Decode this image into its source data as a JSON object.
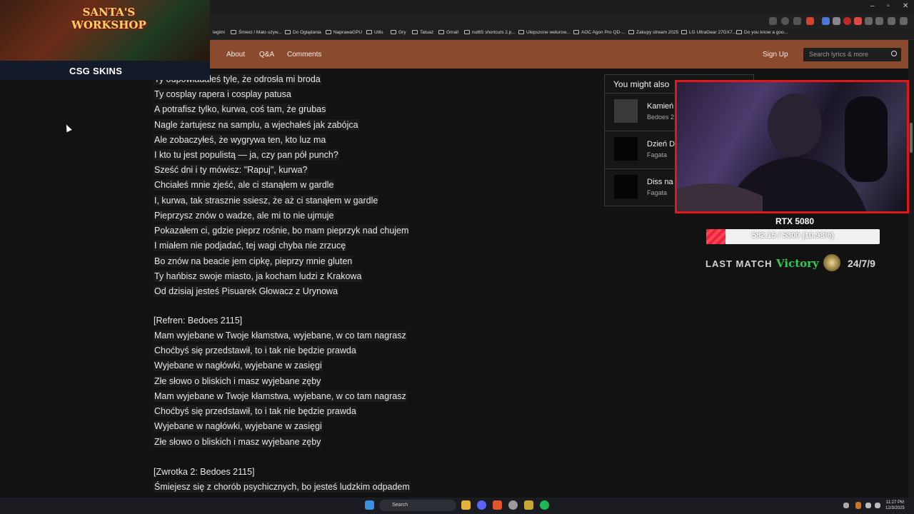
{
  "browser": {
    "bookmarks": [
      "legimi",
      "Śmieci / Mało używ...",
      "Do Oglądania",
      "NaprawaGPU",
      "Utils",
      "Gry",
      "Tatuaż",
      "Gmail",
      "nut65 shortcuts 2.p...",
      "Ulepszone welurow...",
      "AOC Agon Pro QD-...",
      "Zakupy stream 2025",
      "LG UltraGear 27GX7...",
      "Do you know a goo..."
    ]
  },
  "site": {
    "nav": [
      "About",
      "Q&A",
      "Comments"
    ],
    "sign_up": "Sign Up",
    "search_placeholder": "Search lyrics & more"
  },
  "lyrics": [
    "Ty odpowiadałeś tyle, że odrosła mi broda",
    "Ty cosplay rapera i cosplay patusa",
    "A potrafisz tylko, kurwa, coś tam, że grubas",
    "Nagle żartujesz na samplu, a wjechałeś jak zabójca",
    "Ale zobaczyłeś, że wygrywa ten, kto luz ma",
    "I kto tu jest populistą — ja, czy pan pół punch?",
    "Sześć dni i ty mówisz: \"Rapuj\", kurwa?",
    "Chciałeś mnie zjeść, ale ci stanąłem w gardle",
    "I, kurwa, tak strasznie ssiesz, że aż ci stanąłem w gardle",
    "Pieprzysz znów o wadze, ale mi to nie ujmuje",
    "Pokazałem ci, gdzie pieprz rośnie, bo mam pieprzyk nad chujem",
    "I miałem nie podjadać, tej wagi chyba nie zrzucę",
    "Bo znów na beacie jem cipkę, pieprzy mnie gluten",
    "Ty hańbisz swoje miasto, ja kocham ludzi z Krakowa",
    "Od dzisiaj jesteś Pisuarek Głowacz z Urynowa"
  ],
  "refrain_header": "[Refren: Bedoes 2115]",
  "refrain": [
    "Mam wyjebane w Twoje kłamstwa, wyjebane, w co tam nagrasz",
    "Choćbyś się przedstawił, to i tak nie będzie prawda",
    "Wyjebane w nagłówki, wyjebane w zasięgi",
    "Złe słowo o bliskich i masz wyjebane zęby",
    "Mam wyjebane w Twoje kłamstwa, wyjebane, w co tam nagrasz",
    "Choćbyś się przedstawił, to i tak nie będzie prawda",
    "Wyjebane w nagłówki, wyjebane w zasięgi",
    "Złe słowo o bliskich i masz wyjebane zęby"
  ],
  "verse2_header": "[Zwrotka 2: Bedoes 2115]",
  "verse2": [
    "Śmiejesz się z chorób psychicznych, bo jesteś ludzkim odpadem"
  ],
  "sidebar": {
    "title": "You might also",
    "items": [
      {
        "title": "Kamień",
        "artist": "Bedoes 2"
      },
      {
        "title": "Dzień D",
        "artist": "Fagata"
      },
      {
        "title": "Diss na",
        "artist": "Fagata"
      }
    ]
  },
  "stream_overlay": {
    "banner_title_line1": "SANTA'S",
    "banner_title_line2": "WORKSHOP",
    "sponsor": "CSG SKINS",
    "goal_label": "RTX 5080",
    "goal_text": "582.15 / 5300 (10.98%)",
    "goal_progress": 0.1098,
    "last_match_label": "LAST MATCH",
    "last_match_result": "Victory",
    "schedule": "24/7/9",
    "colors": {
      "victory": "#2ecc55",
      "goal_fill": "#e8233a",
      "webcam_border": "#e01818"
    }
  },
  "taskbar": {
    "search_label": "Search",
    "time": "11:27 PM",
    "date": "12/3/2025"
  }
}
